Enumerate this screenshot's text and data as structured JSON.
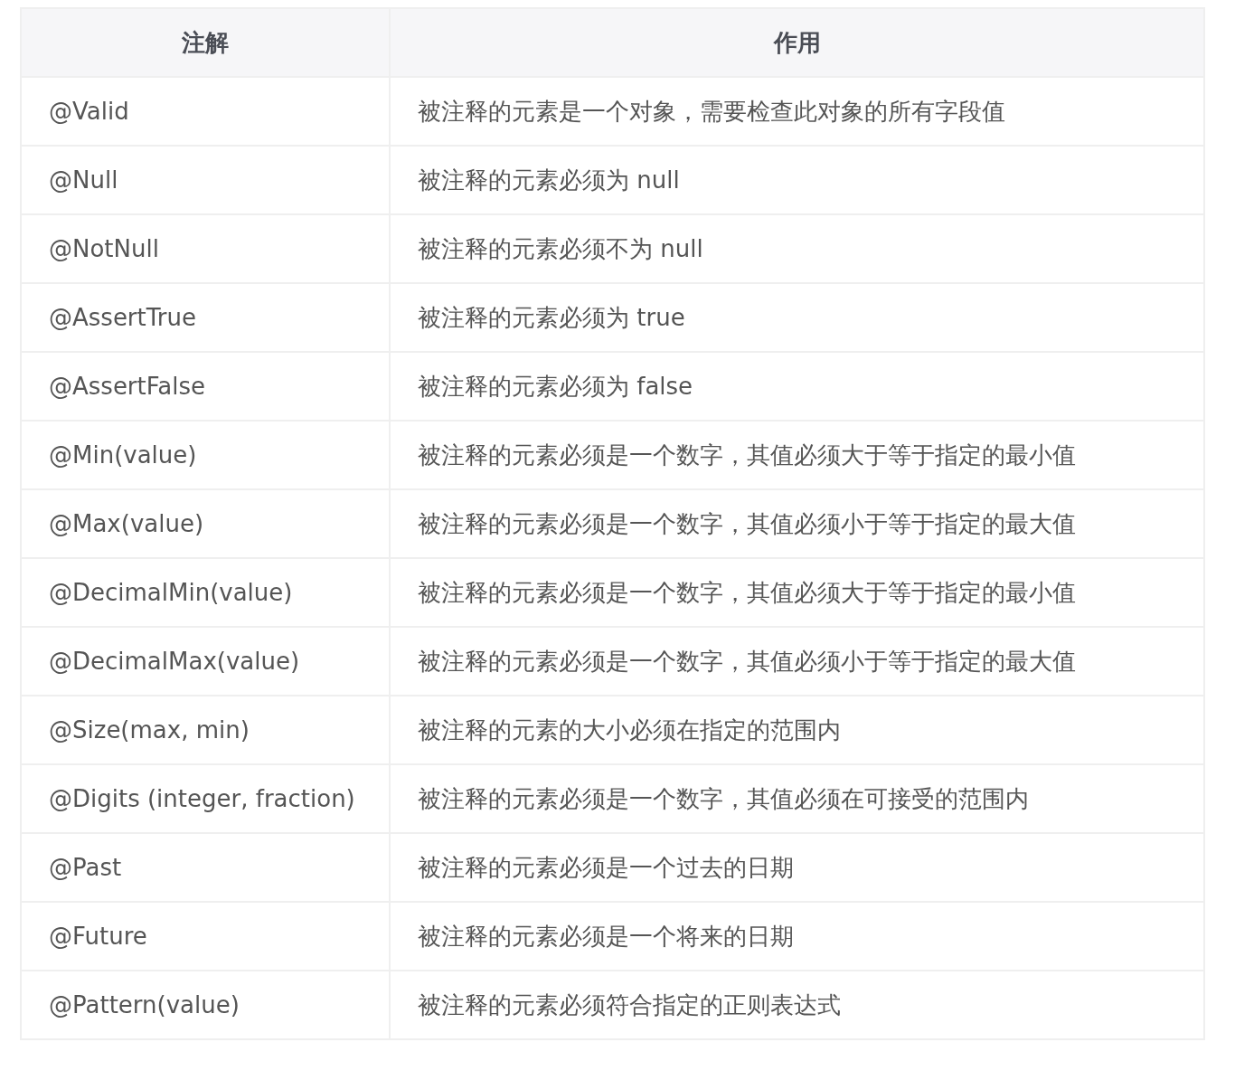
{
  "table": {
    "columns": [
      "注解",
      "作用"
    ],
    "rows": [
      [
        "@Valid",
        "被注释的元素是一个对象，需要检查此对象的所有字段值"
      ],
      [
        "@Null",
        "被注释的元素必须为 null"
      ],
      [
        "@NotNull",
        "被注释的元素必须不为 null"
      ],
      [
        "@AssertTrue",
        "被注释的元素必须为 true"
      ],
      [
        "@AssertFalse",
        "被注释的元素必须为 false"
      ],
      [
        "@Min(value)",
        "被注释的元素必须是一个数字，其值必须大于等于指定的最小值"
      ],
      [
        "@Max(value)",
        "被注释的元素必须是一个数字，其值必须小于等于指定的最大值"
      ],
      [
        "@DecimalMin(value)",
        "被注释的元素必须是一个数字，其值必须大于等于指定的最小值"
      ],
      [
        "@DecimalMax(value)",
        "被注释的元素必须是一个数字，其值必须小于等于指定的最大值"
      ],
      [
        "@Size(max, min)",
        "被注释的元素的大小必须在指定的范围内"
      ],
      [
        "@Digits (integer, fraction)",
        "被注释的元素必须是一个数字，其值必须在可接受的范围内"
      ],
      [
        "@Past",
        "被注释的元素必须是一个过去的日期"
      ],
      [
        "@Future",
        "被注释的元素必须是一个将来的日期"
      ],
      [
        "@Pattern(value)",
        "被注释的元素必须符合指定的正则表达式"
      ]
    ]
  }
}
